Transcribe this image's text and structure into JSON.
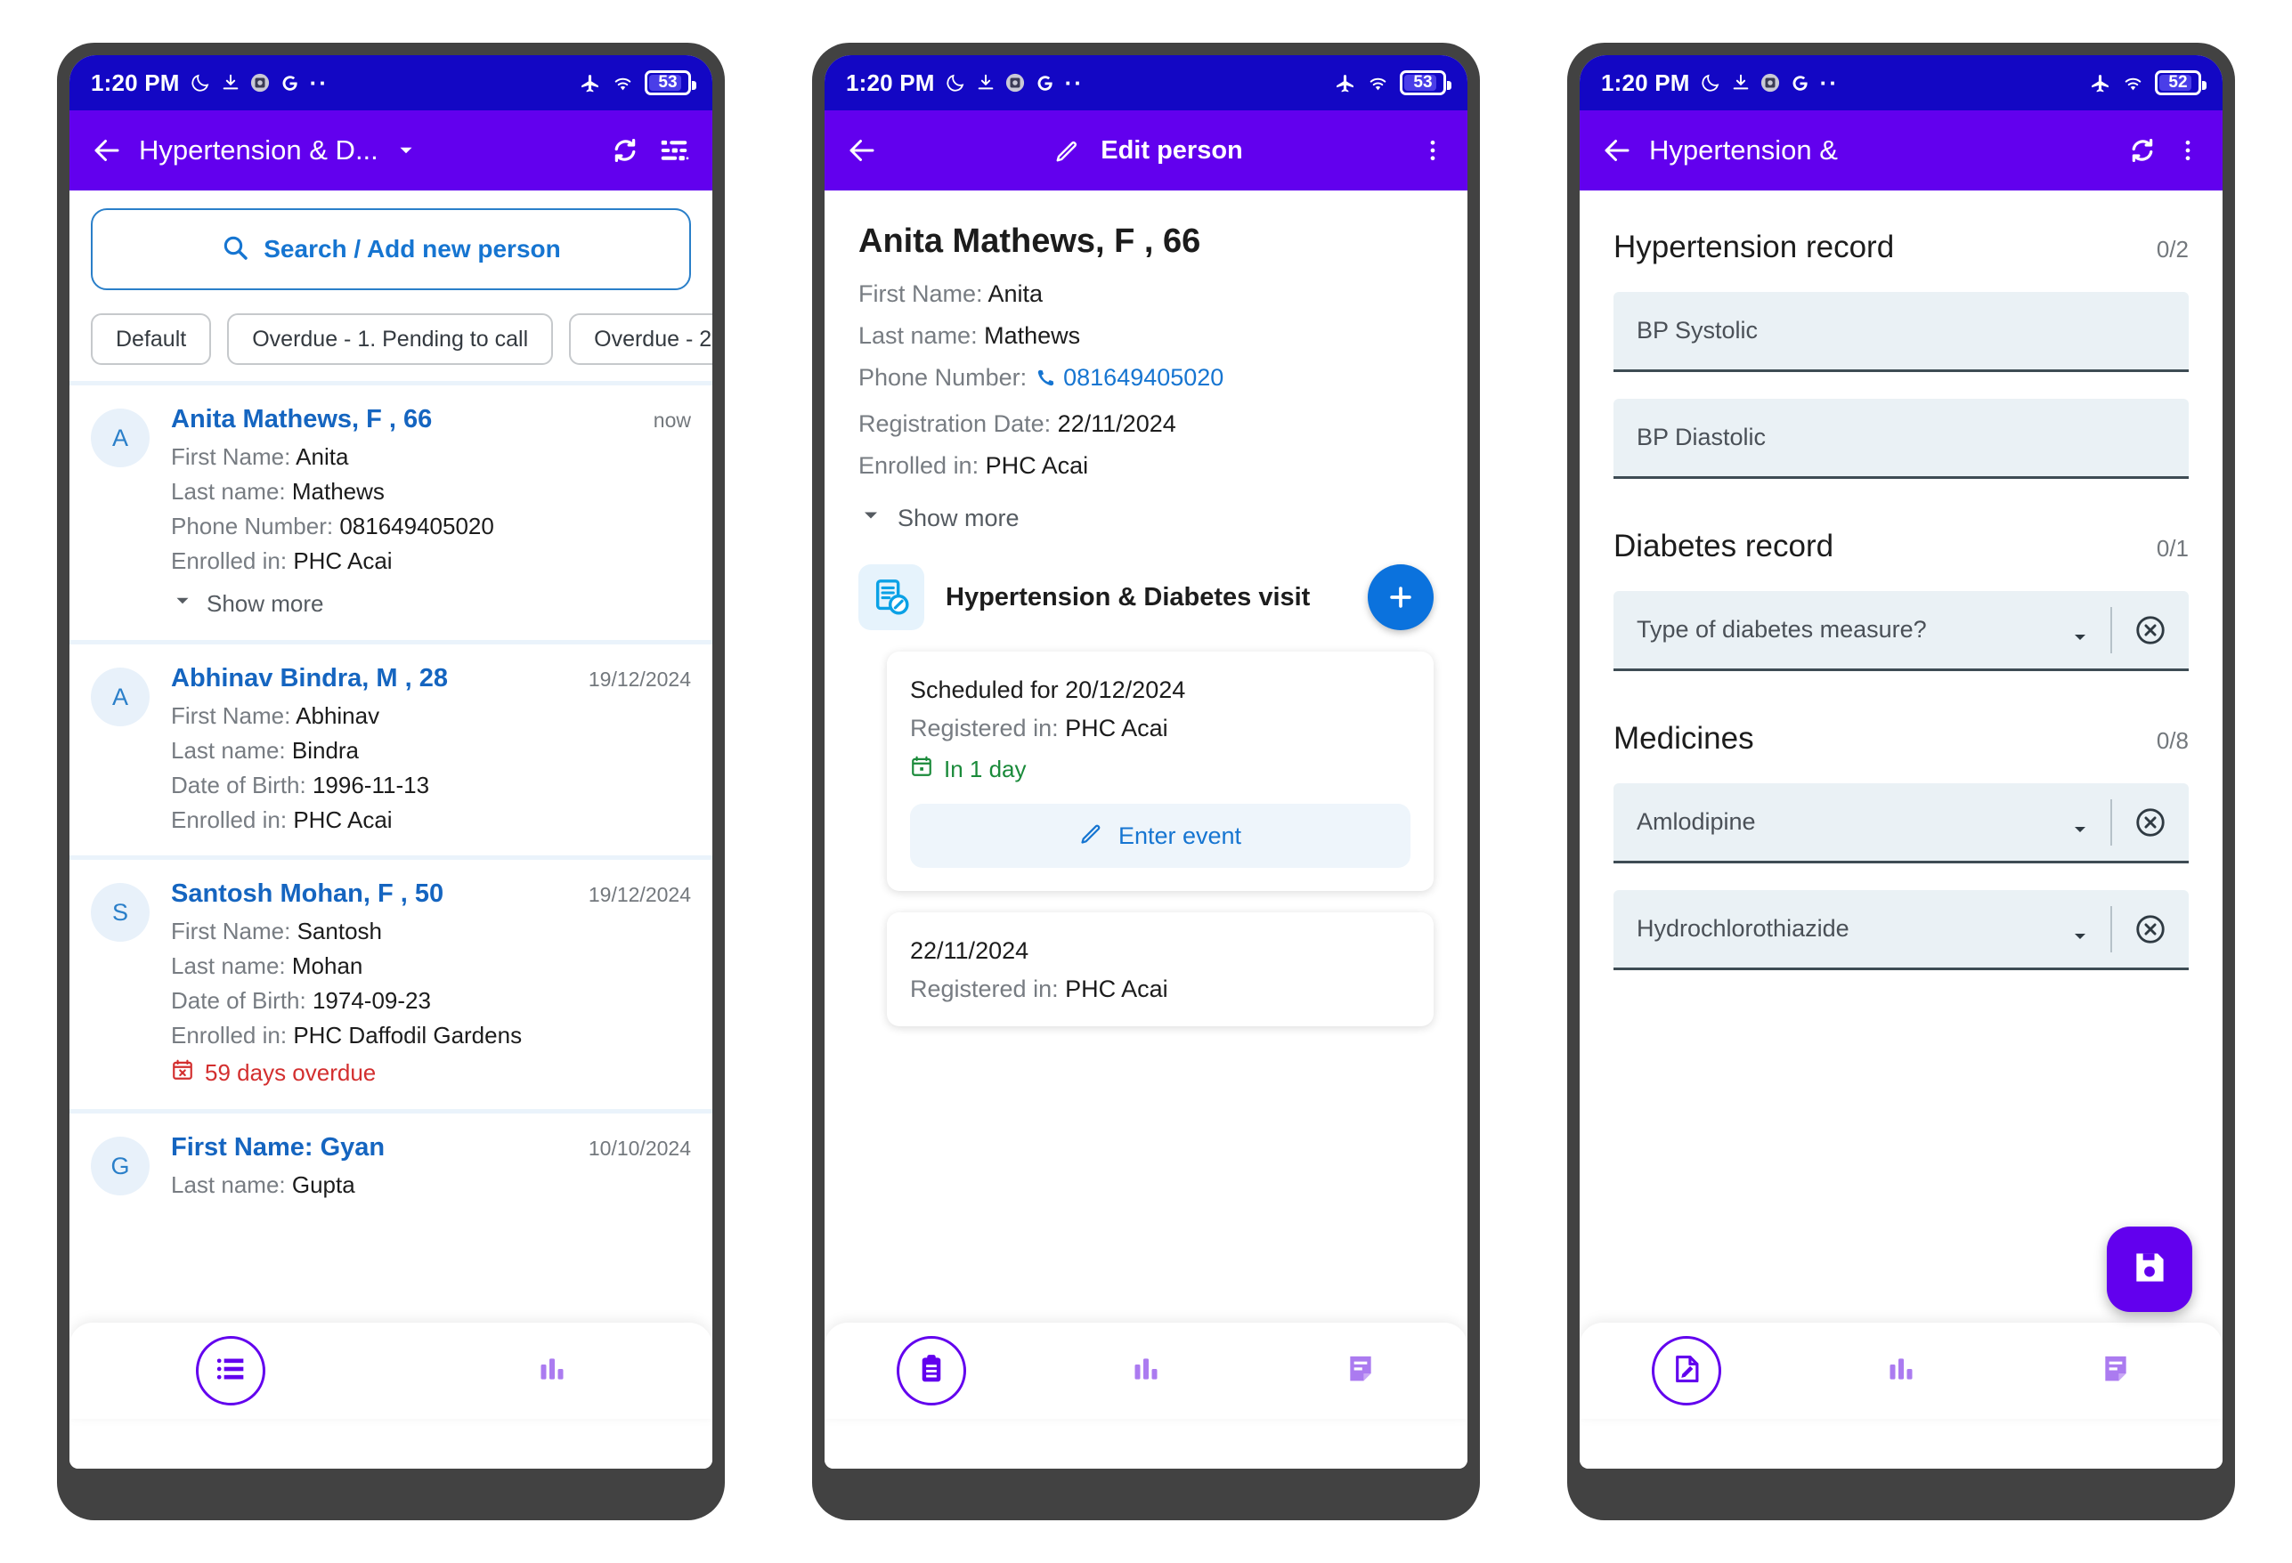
{
  "statusbar": {
    "time": "1:20 PM",
    "icons": [
      "moon-icon",
      "download-icon",
      "screenshot-icon",
      "google-icon",
      "more-dots-icon"
    ],
    "right_icons": [
      "airplane-mode-icon",
      "wifi-icon"
    ],
    "battery_1": "53",
    "battery_2": "53",
    "battery_3": "52"
  },
  "screen1": {
    "appbar": {
      "back": "back-arrow-icon",
      "title": "Hypertension & D...",
      "dropdown": "chevron-down-icon",
      "sync": "sync-icon",
      "filter": "filter-list-icon"
    },
    "search": {
      "icon": "search-icon",
      "label": "Search / Add new person"
    },
    "chips": [
      {
        "label": "Default"
      },
      {
        "label": "Overdue - 1. Pending to call"
      },
      {
        "label": "Overdue - 2"
      }
    ],
    "people": [
      {
        "initial": "A",
        "name": "Anita Mathews, F , 66",
        "time": "now",
        "rows": [
          {
            "label": "First Name: ",
            "value": "Anita"
          },
          {
            "label": "Last name: ",
            "value": "Mathews"
          },
          {
            "label": "Phone Number: ",
            "value": "081649405020"
          },
          {
            "label": "Enrolled in: ",
            "value": "PHC Acai"
          }
        ],
        "show_more": "Show more"
      },
      {
        "initial": "A",
        "name": "Abhinav Bindra, M , 28",
        "time": "19/12/2024",
        "rows": [
          {
            "label": "First Name: ",
            "value": "Abhinav"
          },
          {
            "label": "Last name: ",
            "value": "Bindra"
          },
          {
            "label": "Date of Birth: ",
            "value": "1996-11-13"
          },
          {
            "label": "Enrolled in: ",
            "value": "PHC Acai"
          }
        ]
      },
      {
        "initial": "S",
        "name": "Santosh Mohan, F , 50",
        "time": "19/12/2024",
        "rows": [
          {
            "label": "First Name: ",
            "value": "Santosh"
          },
          {
            "label": "Last name: ",
            "value": "Mohan"
          },
          {
            "label": "Date of Birth: ",
            "value": "1974-09-23"
          },
          {
            "label": "Enrolled in: ",
            "value": "PHC Daffodil Gardens"
          }
        ],
        "overdue": "59 days overdue"
      },
      {
        "initial": "G",
        "name": "First Name: Gyan",
        "time": "10/10/2024",
        "rows": [
          {
            "label": "Last name: ",
            "value": "Gupta"
          }
        ]
      }
    ],
    "bottomnav": [
      {
        "icon": "list-icon",
        "selected": true
      },
      {
        "icon": "bar-chart-icon",
        "selected": false
      }
    ]
  },
  "screen2": {
    "appbar": {
      "back": "back-arrow-icon",
      "edit_icon": "pencil-icon",
      "edit_label": "Edit person",
      "overflow": "more-vertical-icon"
    },
    "person": {
      "title": "Anita Mathews, F , 66",
      "rows": [
        {
          "label": "First Name: ",
          "value": "Anita"
        },
        {
          "label": "Last name: ",
          "value": "Mathews"
        },
        {
          "label": "Registration Date: ",
          "value": "22/11/2024"
        },
        {
          "label": "Enrolled in: ",
          "value": "PHC Acai"
        }
      ],
      "phone_label": "Phone Number: ",
      "phone_value": "081649405020",
      "show_more": "Show more"
    },
    "program": {
      "icon": "document-edit-icon",
      "title": "Hypertension & Diabetes visit",
      "add_button": "plus-icon"
    },
    "events": [
      {
        "line1": "Scheduled for 20/12/2024",
        "label2": "Registered in: ",
        "value2": "PHC Acai",
        "due": "In 1 day",
        "due_icon": "calendar-icon",
        "action_icon": "pencil-icon",
        "action": "Enter event"
      },
      {
        "line1": "22/11/2024",
        "label2": "Registered in: ",
        "value2": "PHC Acai"
      }
    ],
    "bottomnav": [
      {
        "icon": "clipboard-icon",
        "selected": true
      },
      {
        "icon": "bar-chart-icon",
        "selected": false
      },
      {
        "icon": "note-icon",
        "selected": false
      }
    ]
  },
  "screen3": {
    "appbar": {
      "back": "back-arrow-icon",
      "title": "Hypertension &",
      "sync": "sync-icon",
      "overflow": "more-vertical-icon"
    },
    "sections": [
      {
        "title": "Hypertension record",
        "count": "0/2",
        "fields": [
          {
            "label": "BP Systolic",
            "type": "text"
          },
          {
            "label": "BP Diastolic",
            "type": "text"
          }
        ]
      },
      {
        "title": "Diabetes record",
        "count": "0/1",
        "fields": [
          {
            "label": "Type of diabetes measure?",
            "type": "select"
          }
        ]
      },
      {
        "title": "Medicines",
        "count": "0/8",
        "fields": [
          {
            "label": "Amlodipine",
            "type": "select"
          },
          {
            "label": "Hydrochlorothiazide",
            "type": "select"
          }
        ]
      }
    ],
    "save_button": "save-icon",
    "bottomnav": [
      {
        "icon": "edit-note-icon",
        "selected": true
      },
      {
        "icon": "bar-chart-icon",
        "selected": false
      },
      {
        "icon": "note-icon",
        "selected": false
      }
    ]
  },
  "colors": {
    "statusbar": "#1307c4",
    "appbar": "#6200ee",
    "link": "#1565c0",
    "overdue": "#d32f2f",
    "due_ok": "#1a8a3a",
    "accent_blue": "#0b72dd"
  }
}
